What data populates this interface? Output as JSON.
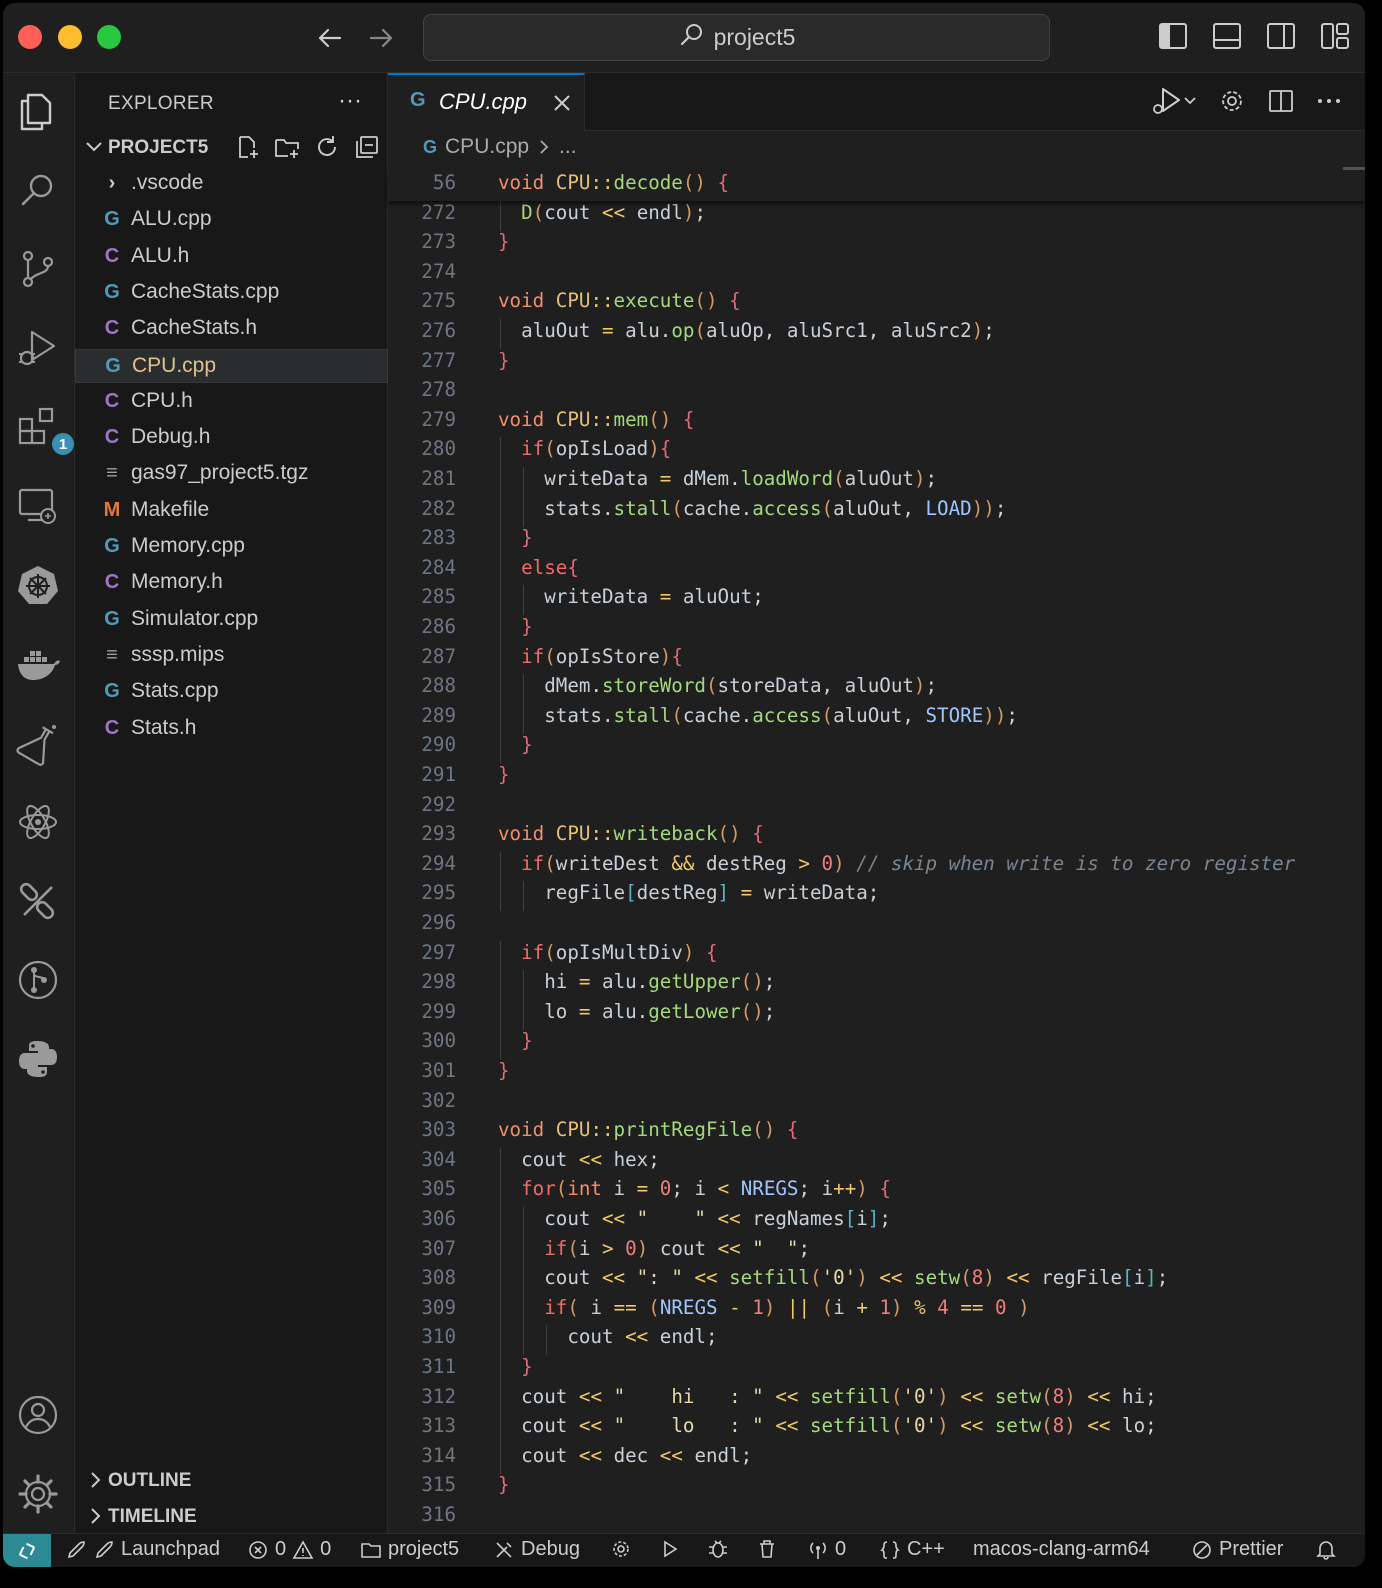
{
  "window": {
    "search_text": "project5"
  },
  "activity_bar": {
    "extensions_badge": "1"
  },
  "sidebar": {
    "title": "EXPLORER",
    "more": "···",
    "project": "PROJECT5",
    "files": [
      {
        "icon": "folder",
        "name": ".vscode"
      },
      {
        "icon": "cpp",
        "name": "ALU.cpp"
      },
      {
        "icon": "h",
        "name": "ALU.h"
      },
      {
        "icon": "cpp",
        "name": "CacheStats.cpp"
      },
      {
        "icon": "h",
        "name": "CacheStats.h"
      },
      {
        "icon": "cpp",
        "name": "CPU.cpp"
      },
      {
        "icon": "h",
        "name": "CPU.h"
      },
      {
        "icon": "h",
        "name": "Debug.h"
      },
      {
        "icon": "text",
        "name": "gas97_project5.tgz"
      },
      {
        "icon": "makefile",
        "name": "Makefile"
      },
      {
        "icon": "cpp",
        "name": "Memory.cpp"
      },
      {
        "icon": "h",
        "name": "Memory.h"
      },
      {
        "icon": "cpp",
        "name": "Simulator.cpp"
      },
      {
        "icon": "text",
        "name": "sssp.mips"
      },
      {
        "icon": "cpp",
        "name": "Stats.cpp"
      },
      {
        "icon": "h",
        "name": "Stats.h"
      }
    ],
    "outline": "OUTLINE",
    "timeline": "TIMELINE"
  },
  "editor": {
    "tab_name": "CPU.cpp",
    "breadcrumb_file": "CPU.cpp",
    "breadcrumb_more": "...",
    "lines": [
      {
        "n": "56",
        "text": "void CPU::decode() {"
      },
      {
        "n": "272",
        "text": "  D(cout << endl);"
      },
      {
        "n": "273",
        "text": "}"
      },
      {
        "n": "274",
        "text": ""
      },
      {
        "n": "275",
        "text": "void CPU::execute() {"
      },
      {
        "n": "276",
        "text": "  aluOut = alu.op(aluOp, aluSrc1, aluSrc2);"
      },
      {
        "n": "277",
        "text": "}"
      },
      {
        "n": "278",
        "text": ""
      },
      {
        "n": "279",
        "text": "void CPU::mem() {"
      },
      {
        "n": "280",
        "text": "  if(opIsLoad){"
      },
      {
        "n": "281",
        "text": "    writeData = dMem.loadWord(aluOut);"
      },
      {
        "n": "282",
        "text": "    stats.stall(cache.access(aluOut, LOAD));"
      },
      {
        "n": "283",
        "text": "  }"
      },
      {
        "n": "284",
        "text": "  else{"
      },
      {
        "n": "285",
        "text": "    writeData = aluOut;"
      },
      {
        "n": "286",
        "text": "  }"
      },
      {
        "n": "287",
        "text": "  if(opIsStore){"
      },
      {
        "n": "288",
        "text": "    dMem.storeWord(storeData, aluOut);"
      },
      {
        "n": "289",
        "text": "    stats.stall(cache.access(aluOut, STORE));"
      },
      {
        "n": "290",
        "text": "  }"
      },
      {
        "n": "291",
        "text": "}"
      },
      {
        "n": "292",
        "text": ""
      },
      {
        "n": "293",
        "text": "void CPU::writeback() {"
      },
      {
        "n": "294",
        "text": "  if(writeDest && destReg > 0) // skip when write is to zero register"
      },
      {
        "n": "295",
        "text": "    regFile[destReg] = writeData;"
      },
      {
        "n": "296",
        "text": ""
      },
      {
        "n": "297",
        "text": "  if(opIsMultDiv) {"
      },
      {
        "n": "298",
        "text": "    hi = alu.getUpper();"
      },
      {
        "n": "299",
        "text": "    lo = alu.getLower();"
      },
      {
        "n": "300",
        "text": "  }"
      },
      {
        "n": "301",
        "text": "}"
      },
      {
        "n": "302",
        "text": ""
      },
      {
        "n": "303",
        "text": "void CPU::printRegFile() {"
      },
      {
        "n": "304",
        "text": "  cout << hex;"
      },
      {
        "n": "305",
        "text": "  for(int i = 0; i < NREGS; i++) {"
      },
      {
        "n": "306",
        "text": "    cout << \"    \" << regNames[i];"
      },
      {
        "n": "307",
        "text": "    if(i > 0) cout << \"  \";"
      },
      {
        "n": "308",
        "text": "    cout << \": \" << setfill('0') << setw(8) << regFile[i];"
      },
      {
        "n": "309",
        "text": "    if( i == (NREGS - 1) || (i + 1) % 4 == 0 )"
      },
      {
        "n": "310",
        "text": "      cout << endl;"
      },
      {
        "n": "311",
        "text": "  }"
      },
      {
        "n": "312",
        "text": "  cout << \"    hi   : \" << setfill('0') << setw(8) << hi;"
      },
      {
        "n": "313",
        "text": "  cout << \"    lo   : \" << setfill('0') << setw(8) << lo;"
      },
      {
        "n": "314",
        "text": "  cout << dec << endl;"
      },
      {
        "n": "315",
        "text": "}"
      },
      {
        "n": "316",
        "text": ""
      }
    ]
  },
  "statusbar": {
    "launchpad": "Launchpad",
    "errors": "0",
    "warnings": "0",
    "project": "project5",
    "debug": "Debug",
    "ports": "0",
    "language": "C++",
    "config": "macos-clang-arm64",
    "prettier": "Prettier"
  },
  "colors": {
    "accent": "#0078d4",
    "remote": "#2b8a94",
    "active_file": "#e2c08d",
    "cpp_icon": "#519aba",
    "h_icon": "#a074c4",
    "makefile_icon": "#e37933"
  }
}
